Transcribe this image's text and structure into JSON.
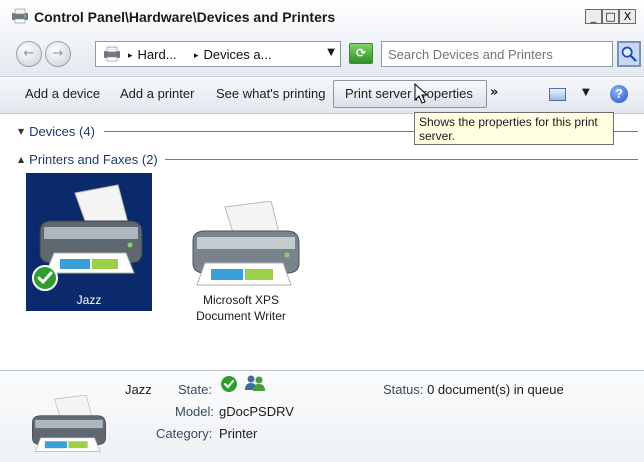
{
  "window": {
    "title": "Control Panel\\Hardware\\Devices and Printers",
    "minimize_glyph": "_",
    "maximize_glyph": "□",
    "close_glyph": "X"
  },
  "addressbar": {
    "back_glyph": "←",
    "forward_glyph": "→",
    "breadcrumbs": [
      "Hard...",
      "Devices a..."
    ],
    "crumb_arrow": "▸",
    "dropdown_glyph": "▼",
    "refresh_glyph": "⟳",
    "search_placeholder": "Search Devices and Printers"
  },
  "commandbar": {
    "add_device": "Add a device",
    "add_printer": "Add a printer",
    "see_printing": "See what's printing",
    "print_server": "Print server properties",
    "more": "»",
    "view_drop": "▼",
    "help": "?"
  },
  "tooltip": {
    "text": "Shows the properties for this print server."
  },
  "groups": {
    "devices": {
      "label": "Devices (4)",
      "tri": "▼"
    },
    "printers": {
      "label": "Printers and Faxes (2)",
      "tri": "▲"
    }
  },
  "printers": [
    {
      "name": "Jazz",
      "selected": true,
      "default": true
    },
    {
      "name": "Microsoft XPS Document Writer",
      "selected": false,
      "default": false
    }
  ],
  "details": {
    "name": "Jazz",
    "state_label": "State:",
    "model_label": "Model:",
    "model_value": "gDocPSDRV",
    "category_label": "Category:",
    "category_value": "Printer",
    "status_label": "Status:",
    "status_value": "0 document(s) in queue"
  },
  "icons": {
    "app": "devices-printers-icon",
    "printer": "printer-icon",
    "default_check": "default-checkmark-icon",
    "shared": "shared-users-icon",
    "search": "search-icon",
    "refresh": "refresh-icon",
    "view": "view-options-icon",
    "help": "help-icon"
  },
  "colors": {
    "selection": "#0a2a6c",
    "group_text": "#1c3b70",
    "tooltip_bg": "#ffffe1",
    "check_green": "#2f9e2f"
  }
}
